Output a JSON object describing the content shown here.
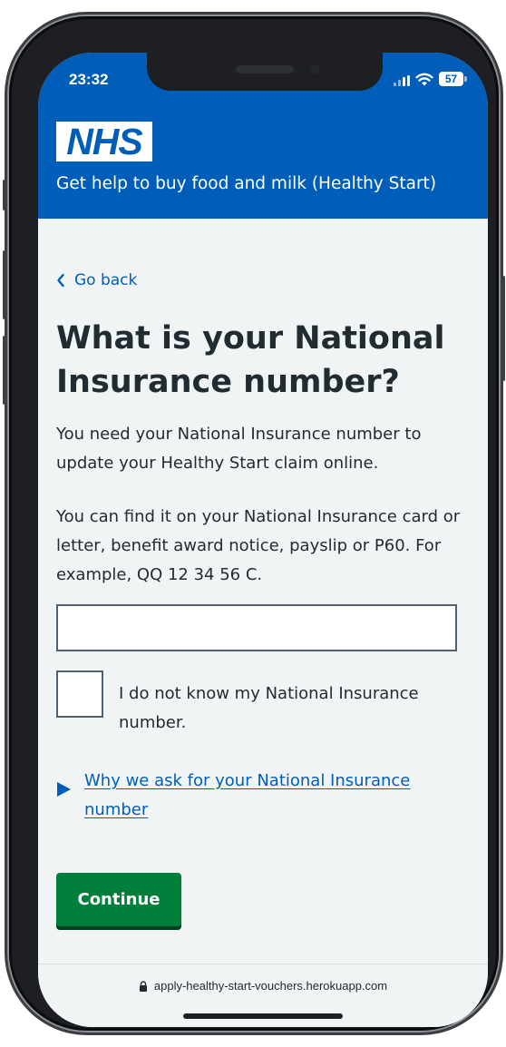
{
  "status_bar": {
    "time": "23:32",
    "battery_level": "57",
    "icons": [
      "signal-icon",
      "wifi-icon",
      "battery-icon"
    ]
  },
  "header": {
    "logo": "NHS",
    "service_name": "Get help to buy food and milk (Healthy Start)",
    "background_color": "#005eb8"
  },
  "back_link": {
    "label": "Go back",
    "icon": "chevron-left-icon"
  },
  "question": {
    "title": "What is your National Insurance number?",
    "hint_1": "You need your National Insurance number to update your Healthy Start claim online.",
    "hint_2": "You can find it on your National Insurance card or letter, benefit award notice, payslip or P60. For example, QQ 12 34 56 C."
  },
  "ni_input": {
    "value": "",
    "placeholder": ""
  },
  "unknown_checkbox": {
    "label": "I do not know my National Insurance number.",
    "checked": false
  },
  "details": {
    "summary": "Why we ask for your National Insurance number",
    "icon": "triangle-right-icon"
  },
  "continue_button": {
    "label": "Continue",
    "color": "#007f3b"
  },
  "browser": {
    "url": "apply-healthy-start-vouchers.herokuapp.com",
    "icon": "lock-icon"
  }
}
